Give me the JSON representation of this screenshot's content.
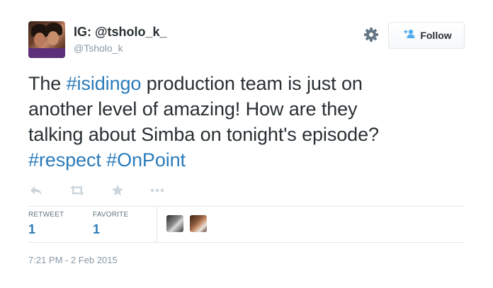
{
  "header": {
    "display_name": "IG: @tsholo_k_",
    "handle": "@Tsholo_k",
    "follow_label": "Follow"
  },
  "tweet": {
    "line1_pre": "The ",
    "line1_hashtag": "#isidingo",
    "line1_post": " production team is just on",
    "line2": "another level of amazing! How are they",
    "line3": "talking about Simba on tonight's episode?",
    "hashtag_respect": "#respect",
    "hashtag_onpoint": "#OnPoint"
  },
  "actions": {
    "icons": [
      "reply-icon",
      "retweet-icon",
      "favorite-icon",
      "more-icon"
    ]
  },
  "stats": {
    "retweet_label": "RETWEET",
    "retweet_count": "1",
    "favorite_label": "FAVORITE",
    "favorite_count": "1"
  },
  "footer": {
    "timestamp": "7:21 PM - 2 Feb 2015"
  },
  "colors": {
    "link": "#2b7bb9",
    "text": "#292f33",
    "muted": "#8899a6",
    "border": "#e1e8ed",
    "icon": "#ccd6dd"
  }
}
